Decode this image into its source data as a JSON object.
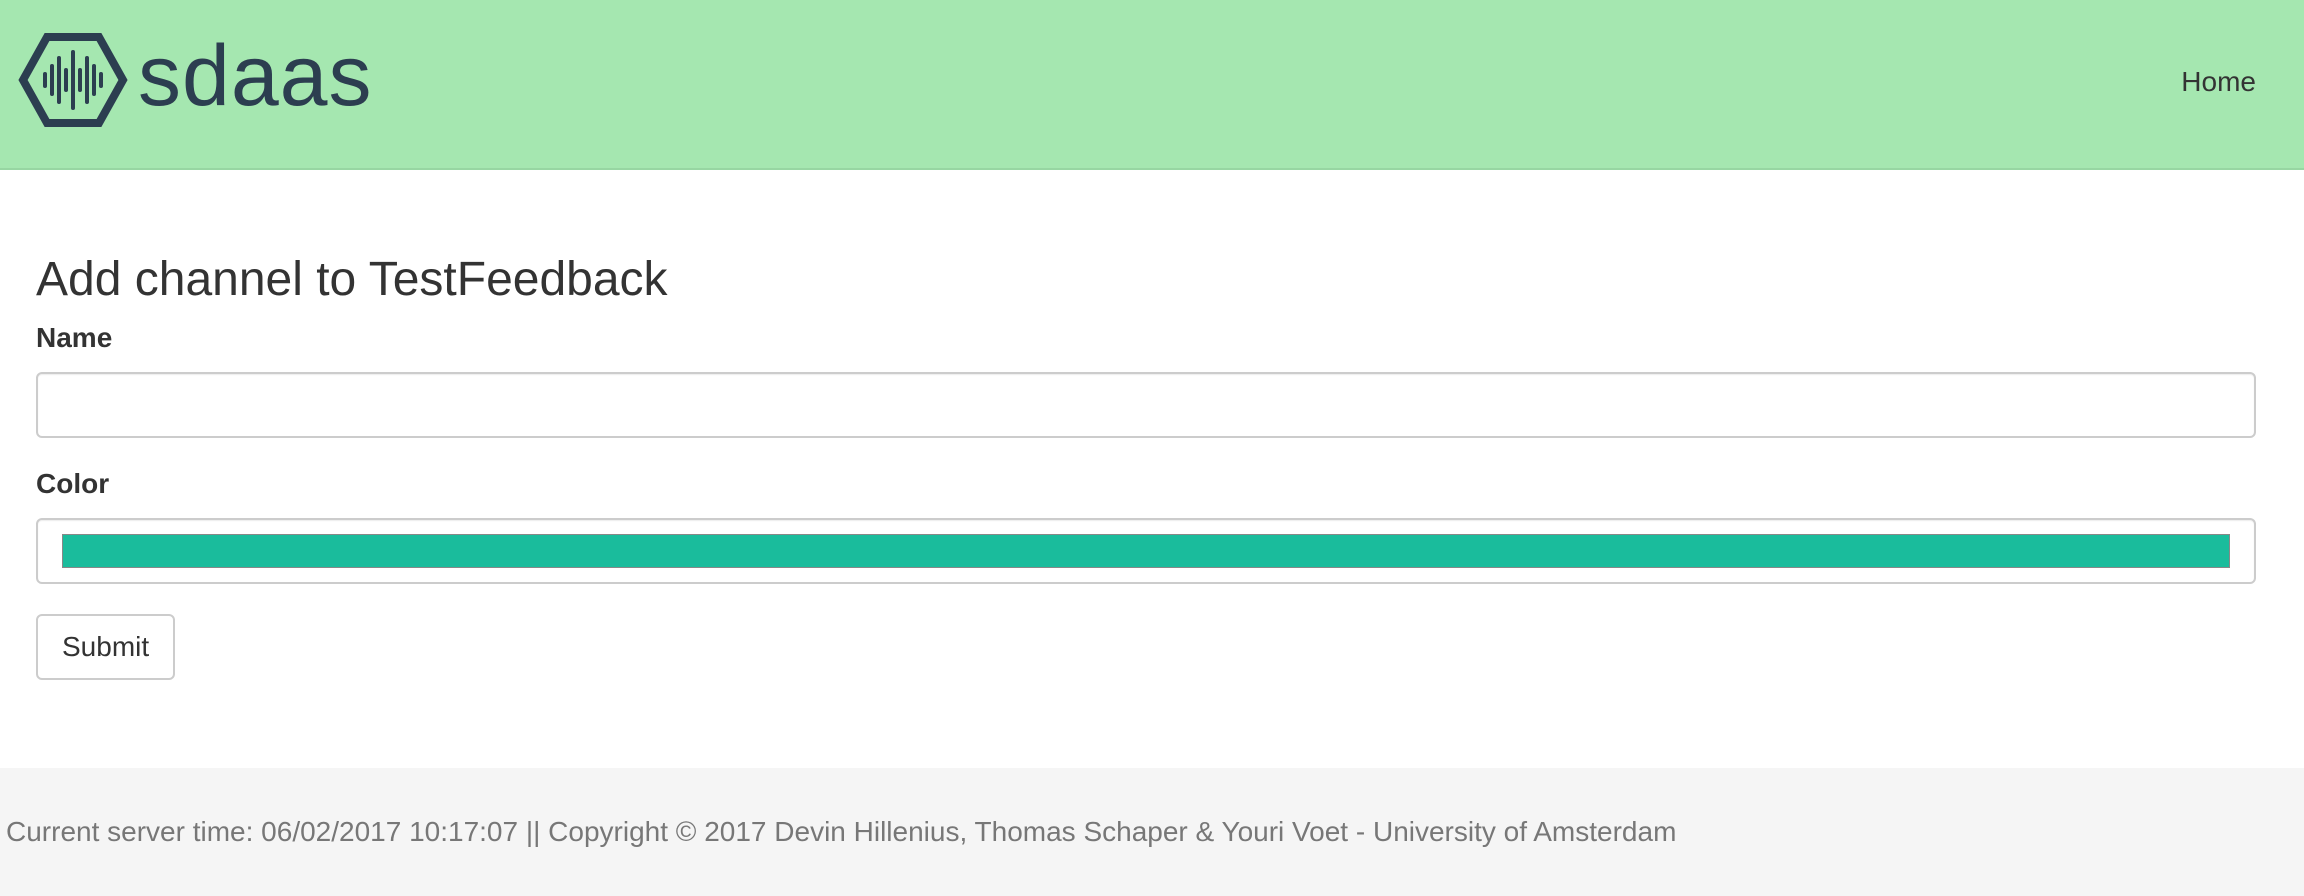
{
  "header": {
    "brand_name": "sdaas",
    "logo_icon": "hexagon-soundwave-icon",
    "nav": {
      "home_label": "Home"
    },
    "background_color": "#a5e7b0",
    "brand_color": "#2c3e50"
  },
  "main": {
    "title": "Add channel to TestFeedback",
    "form": {
      "name_label": "Name",
      "name_value": "",
      "name_placeholder": "",
      "color_label": "Color",
      "color_value": "#1abc9c",
      "submit_label": "Submit"
    }
  },
  "footer": {
    "text": "Current server time: 06/02/2017 10:17:07 || Copyright © 2017 Devin Hillenius, Thomas Schaper & Youri Voet - University of Amsterdam"
  }
}
